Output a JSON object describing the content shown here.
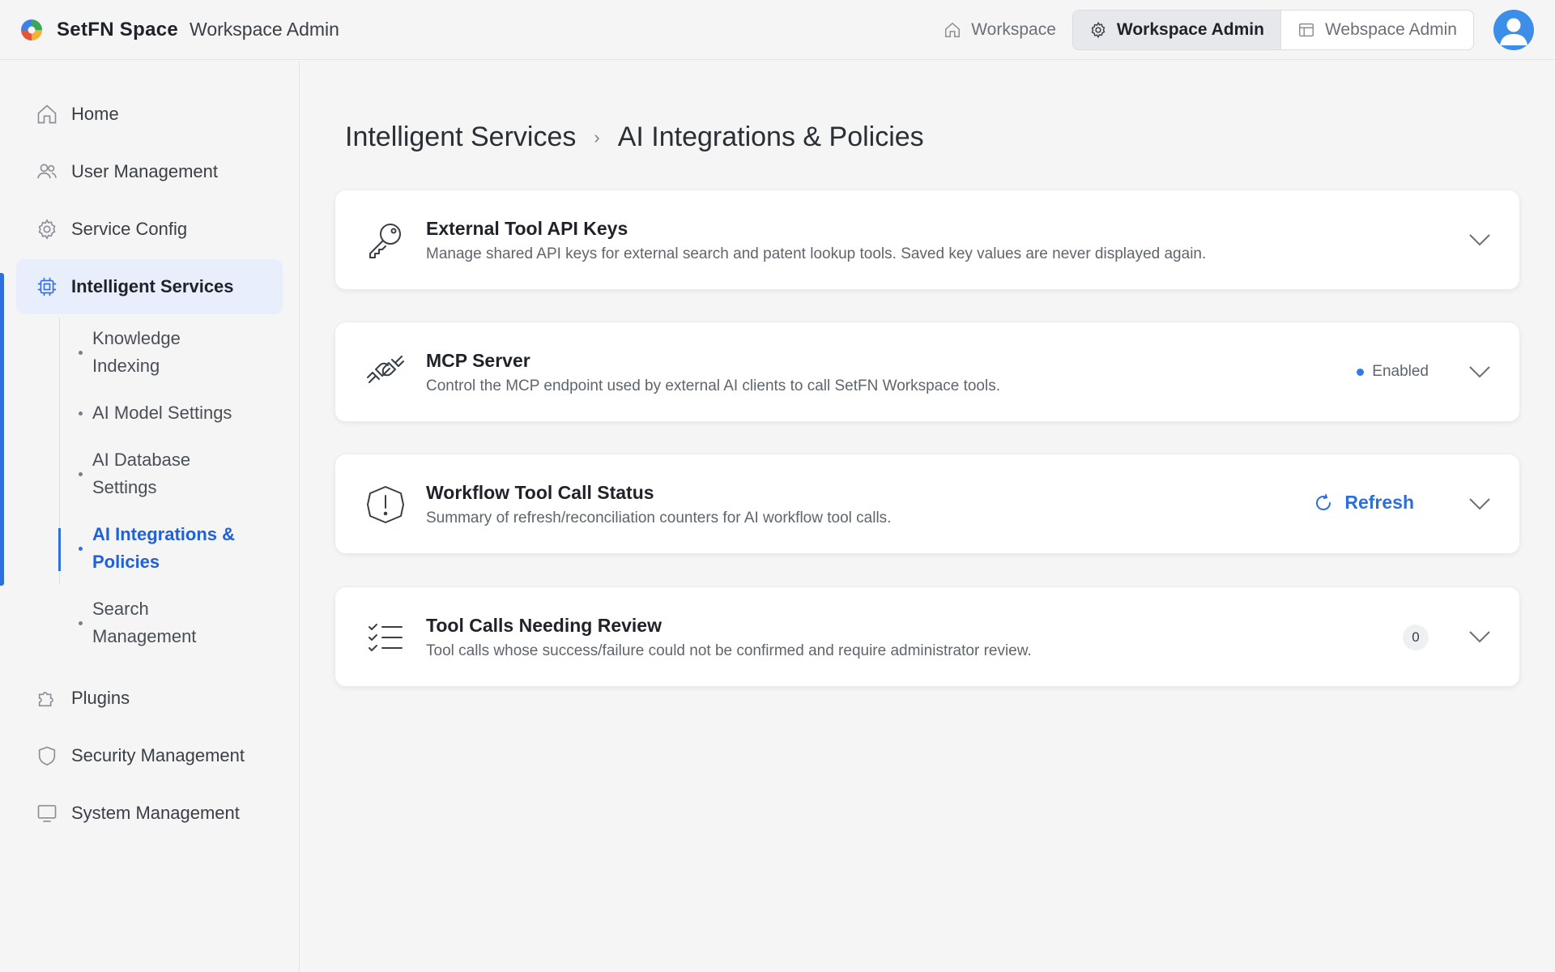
{
  "header": {
    "brand": "SetFN Space",
    "subtitle": "Workspace Admin",
    "nav_workspace": "Workspace",
    "nav_workspace_admin": "Workspace Admin",
    "nav_webspace_admin": "Webspace Admin"
  },
  "sidebar": {
    "items": [
      {
        "label": "Home",
        "icon": "home-icon"
      },
      {
        "label": "User Management",
        "icon": "users-icon"
      },
      {
        "label": "Service Config",
        "icon": "gear-icon"
      },
      {
        "label": "Intelligent Services",
        "icon": "chip-icon",
        "active": true
      },
      {
        "label": "Plugins",
        "icon": "puzzle-icon"
      },
      {
        "label": "Security Management",
        "icon": "shield-icon"
      },
      {
        "label": "System Management",
        "icon": "monitor-icon"
      }
    ],
    "sub_items": [
      {
        "line1": "Knowledge",
        "line2": "Indexing"
      },
      {
        "line1": "AI Model Settings",
        "line2": ""
      },
      {
        "line1": "AI Database",
        "line2": "Settings"
      },
      {
        "line1": "AI Integrations &",
        "line2": "Policies",
        "active": true
      },
      {
        "line1": "Search",
        "line2": "Management"
      }
    ]
  },
  "breadcrumb": {
    "parent": "Intelligent Services",
    "current": "AI Integrations & Policies"
  },
  "cards": [
    {
      "title": "External Tool API Keys",
      "description": "Manage shared API keys for external search and patent lookup tools. Saved key values are never displayed again.",
      "icon": "key-icon"
    },
    {
      "title": "MCP Server",
      "description": "Control the MCP endpoint used by external AI clients to call SetFN Workspace tools.",
      "icon": "plug-icon",
      "status": "Enabled"
    },
    {
      "title": "Workflow Tool Call Status",
      "description": "Summary of refresh/reconciliation counters for AI workflow tool calls.",
      "icon": "alert-icon",
      "action": "Refresh"
    },
    {
      "title": "Tool Calls Needing Review",
      "description": "Tool calls whose success/failure could not be confirmed and require administrator review.",
      "icon": "checklist-icon",
      "count": "0"
    }
  ],
  "colors": {
    "accent": "#2f6fe0",
    "active_bg": "#e8eefb",
    "status_dot": "#2f7be8"
  }
}
